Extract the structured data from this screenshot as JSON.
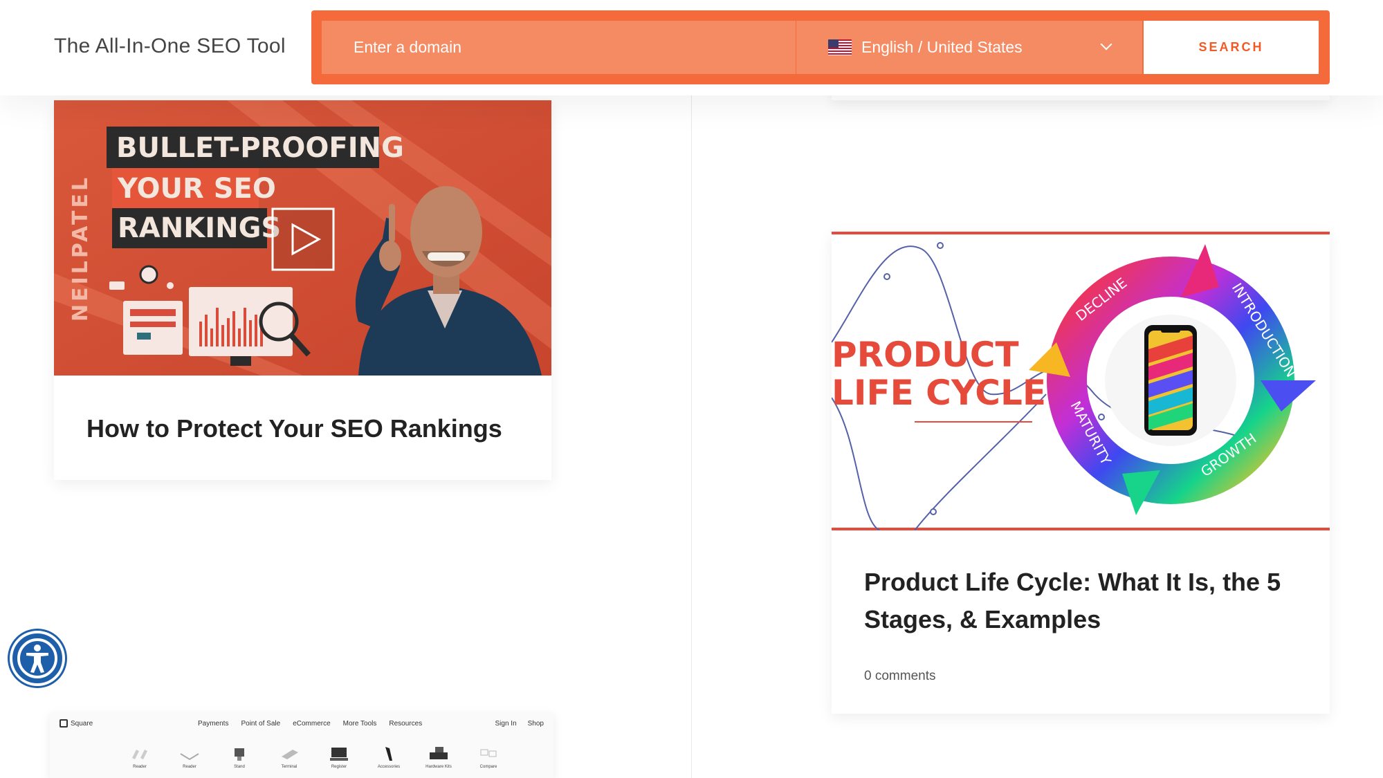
{
  "header": {
    "brand": "The All-In-One SEO Tool",
    "domain_placeholder": "Enter a domain",
    "language": "English / United States",
    "search_label": "SEARCH"
  },
  "colors": {
    "accent": "#f46a3b",
    "accent_light": "#f58b62",
    "search_text": "#f15a24",
    "accessibility": "#1d5fa8"
  },
  "cards": [
    {
      "title": "How to Protect Your SEO Rankings",
      "thumbnail": {
        "brand": "NEILPATEL",
        "headline": [
          "BULLET-PROOFING",
          "YOUR SEO",
          "RANKINGS"
        ]
      }
    },
    {
      "title": "Product Life Cycle: What It Is, the 5 Stages, & Examples",
      "comments": "0 comments",
      "thumbnail": {
        "headline": [
          "PRODUCT",
          "LIFE CYCLE"
        ],
        "stages": [
          "DECLINE",
          "INTRODUCTION",
          "GROWTH",
          "MATURITY"
        ]
      }
    }
  ],
  "partial_card": {
    "logo": "Square",
    "nav": [
      "Payments",
      "Point of Sale",
      "eCommerce",
      "More Tools",
      "Resources"
    ],
    "nav_right": [
      "Sign In",
      "Shop"
    ],
    "items": [
      "Reader",
      "Reader",
      "Stand",
      "Terminal",
      "Register",
      "Accessories",
      "Hardware Kits",
      "Compare"
    ]
  },
  "icons": {
    "accessibility": "accessibility-icon",
    "play": "play-icon",
    "flag": "us-flag-icon",
    "dropdown": "chevron-down-icon"
  }
}
